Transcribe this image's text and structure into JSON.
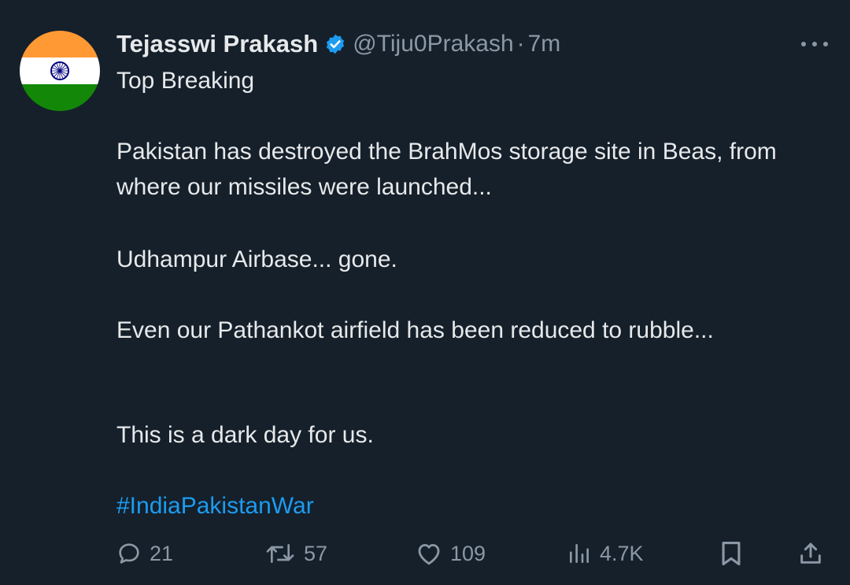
{
  "author": {
    "name": "Tejasswi Prakash",
    "handle": "@Tiju0Prakash",
    "separator": "·",
    "time": "7m",
    "avatar_icon": "india-flag-avatar",
    "verified_color": "#1d9bf0"
  },
  "tweet": {
    "lines": {
      "top": "Top Breaking",
      "p1": "Pakistan has destroyed the BrahMos storage site in Beas, from where our missiles were launched...",
      "p2": "Udhampur Airbase... gone.",
      "p3": "Even our Pathankot airfield has been reduced to rubble...",
      "p4": "This is a dark day for us."
    },
    "hashtag": "#IndiaPakistanWar"
  },
  "actions": {
    "replies": "21",
    "retweets": "57",
    "likes": "109",
    "views": "4.7K"
  },
  "colors": {
    "background": "#15202b",
    "text": "#e7e9ea",
    "secondary": "#8b98a5",
    "link": "#1d9bf0"
  }
}
